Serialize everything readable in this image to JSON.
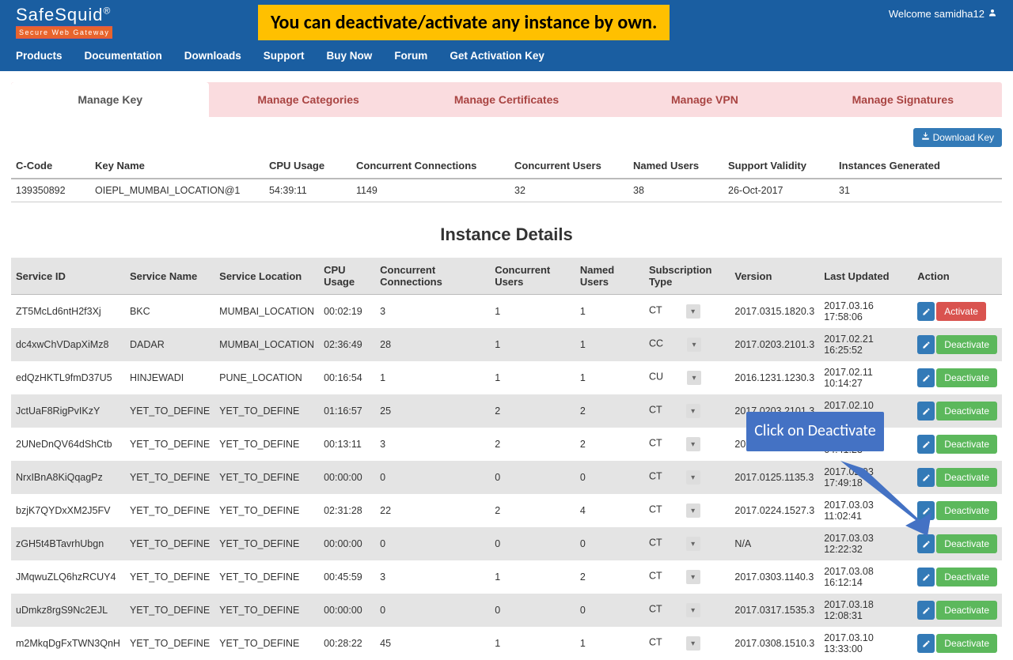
{
  "header": {
    "logo_main": "SafeSquid",
    "logo_sub": "Secure Web Gateway",
    "banner": "You can deactivate/activate any instance by own.",
    "welcome": "Welcome samidha12",
    "nav": [
      "Products",
      "Documentation",
      "Downloads",
      "Support",
      "Buy Now",
      "Forum",
      "Get Activation Key"
    ]
  },
  "tabs": [
    "Manage Key",
    "Manage Categories",
    "Manage Certificates",
    "Manage VPN",
    "Manage Signatures"
  ],
  "download_key_label": "Download Key",
  "key_table": {
    "headers": [
      "C-Code",
      "Key Name",
      "CPU Usage",
      "Concurrent Connections",
      "Concurrent Users",
      "Named Users",
      "Support Validity",
      "Instances Generated"
    ],
    "row": [
      "139350892",
      "OIEPL_MUMBAI_LOCATION@1",
      "54:39:11",
      "1149",
      "32",
      "38",
      "26-Oct-2017",
      "31"
    ]
  },
  "section_title": "Instance Details",
  "callout": "Click on Deactivate",
  "inst_headers": [
    "Service ID",
    "Service Name",
    "Service Location",
    "CPU Usage",
    "Concurrent Connections",
    "Concurrent Users",
    "Named Users",
    "Subscription Type",
    "Version",
    "Last Updated",
    "Action"
  ],
  "action_labels": {
    "activate": "Activate",
    "deactivate": "Deactivate"
  },
  "instances": [
    {
      "id": "ZT5McLd6ntH2f3Xj",
      "name": "BKC",
      "loc": "MUMBAI_LOCATION",
      "cpu": "00:02:19",
      "cc": "3",
      "cu": "1",
      "nu": "1",
      "sub": "CT",
      "ver": "2017.0315.1820.3",
      "upd": "2017.03.16 17:58:06",
      "action": "activate"
    },
    {
      "id": "dc4xwChVDapXiMz8",
      "name": "DADAR",
      "loc": "MUMBAI_LOCATION",
      "cpu": "02:36:49",
      "cc": "28",
      "cu": "1",
      "nu": "1",
      "sub": "CC",
      "ver": "2017.0203.2101.3",
      "upd": "2017.02.21 16:25:52",
      "action": "deactivate"
    },
    {
      "id": "edQzHKTL9fmD37U5",
      "name": "HINJEWADI",
      "loc": "PUNE_LOCATION",
      "cpu": "00:16:54",
      "cc": "1",
      "cu": "1",
      "nu": "1",
      "sub": "CU",
      "ver": "2016.1231.1230.3",
      "upd": "2017.02.11 10:14:27",
      "action": "deactivate"
    },
    {
      "id": "JctUaF8RigPvIKzY",
      "name": "YET_TO_DEFINE",
      "loc": "YET_TO_DEFINE",
      "cpu": "01:16:57",
      "cc": "25",
      "cu": "2",
      "nu": "2",
      "sub": "CT",
      "ver": "2017.0203.2101.3",
      "upd": "2017.02.10 16:58:11",
      "action": "deactivate"
    },
    {
      "id": "2UNeDnQV64dShCtb",
      "name": "YET_TO_DEFINE",
      "loc": "YET_TO_DEFINE",
      "cpu": "00:13:11",
      "cc": "3",
      "cu": "2",
      "nu": "2",
      "sub": "CT",
      "ver": "2017.0203.2101.3",
      "upd": "2017.02.05 04:41:23",
      "action": "deactivate"
    },
    {
      "id": "NrxIBnA8KiQqagPz",
      "name": "YET_TO_DEFINE",
      "loc": "YET_TO_DEFINE",
      "cpu": "00:00:00",
      "cc": "0",
      "cu": "0",
      "nu": "0",
      "sub": "CT",
      "ver": "2017.0125.1135.3",
      "upd": "2017.02.03 17:49:18",
      "action": "deactivate"
    },
    {
      "id": "bzjK7QYDxXM2J5FV",
      "name": "YET_TO_DEFINE",
      "loc": "YET_TO_DEFINE",
      "cpu": "02:31:28",
      "cc": "22",
      "cu": "2",
      "nu": "4",
      "sub": "CT",
      "ver": "2017.0224.1527.3",
      "upd": "2017.03.03 11:02:41",
      "action": "deactivate"
    },
    {
      "id": "zGH5t4BTavrhUbgn",
      "name": "YET_TO_DEFINE",
      "loc": "YET_TO_DEFINE",
      "cpu": "00:00:00",
      "cc": "0",
      "cu": "0",
      "nu": "0",
      "sub": "CT",
      "ver": "N/A",
      "upd": "2017.03.03 12:22:32",
      "action": "deactivate"
    },
    {
      "id": "JMqwuZLQ6hzRCUY4",
      "name": "YET_TO_DEFINE",
      "loc": "YET_TO_DEFINE",
      "cpu": "00:45:59",
      "cc": "3",
      "cu": "1",
      "nu": "2",
      "sub": "CT",
      "ver": "2017.0303.1140.3",
      "upd": "2017.03.08 16:12:14",
      "action": "deactivate"
    },
    {
      "id": "uDmkz8rgS9Nc2EJL",
      "name": "YET_TO_DEFINE",
      "loc": "YET_TO_DEFINE",
      "cpu": "00:00:00",
      "cc": "0",
      "cu": "0",
      "nu": "0",
      "sub": "CT",
      "ver": "2017.0317.1535.3",
      "upd": "2017.03.18 12:08:31",
      "action": "deactivate"
    },
    {
      "id": "m2MkqDgFxTWN3QnH",
      "name": "YET_TO_DEFINE",
      "loc": "YET_TO_DEFINE",
      "cpu": "00:28:22",
      "cc": "45",
      "cu": "1",
      "nu": "1",
      "sub": "CT",
      "ver": "2017.0308.1510.3",
      "upd": "2017.03.10 13:33:00",
      "action": "deactivate"
    }
  ]
}
